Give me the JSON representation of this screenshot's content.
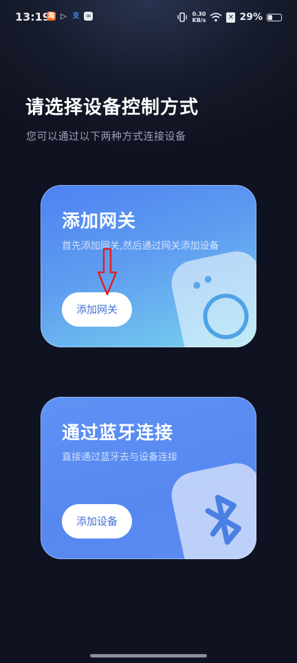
{
  "status_bar": {
    "time": "13:19",
    "notifications": [
      "taobao-icon",
      "play-icon",
      "alipay-icon",
      "link-icon"
    ],
    "taobao_glyph": "淘",
    "alipay_glyph": "支",
    "net_speed_value": "0.30",
    "net_speed_unit": "KB/s",
    "battery_percent": "29%",
    "battery_level": 0.29
  },
  "header": {
    "title": "请选择设备控制方式",
    "subtitle": "您可以通过以下两种方式连接设备"
  },
  "cards": [
    {
      "title": "添加网关",
      "description": "首先添加网关,然后通过网关添加设备",
      "button_label": "添加网关",
      "illustration": "gateway-device-icon"
    },
    {
      "title": "通过蓝牙连接",
      "description": "直接通过蓝牙去与设备连接",
      "button_label": "添加设备",
      "illustration": "bluetooth-icon"
    }
  ],
  "colors": {
    "background": "#161b2b",
    "card_gateway_start": "#4d82f2",
    "card_gateway_end": "#76d3ee",
    "card_bluetooth": "#5a8cf2",
    "button_text": "#3f6fd6",
    "annotation_arrow": "#e0201e"
  }
}
